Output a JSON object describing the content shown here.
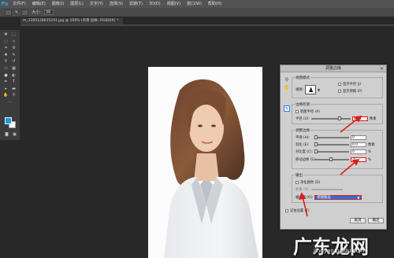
{
  "app": {
    "logo": "Ps"
  },
  "menu": [
    "文件(F)",
    "编辑(E)",
    "图像(I)",
    "图层(L)",
    "文字(Y)",
    "选择(S)",
    "滤镜(T)",
    "3D(D)",
    "视图(V)",
    "窗口(W)",
    "帮助(H)"
  ],
  "options": {
    "size_label": "大小:",
    "size_value": "36"
  },
  "document": {
    "tab_title": "m_1385128635201.jpg @ 100% (背景 副本, RGB/8#) *"
  },
  "dialog": {
    "title": "调整边缘",
    "view_mode": {
      "section": "视图模式",
      "view_label": "视图:",
      "show_radius": "显示半径 (J)",
      "show_original": "显示原稿 (P)"
    },
    "edge_detection": {
      "section": "边缘检测",
      "smart_radius": "智能半径 (A)",
      "radius_label": "半径 (U):",
      "radius_value": "96.5",
      "radius_unit": "像素",
      "radius_fraction": 0.75
    },
    "adjust_edge": {
      "section": "调整边缘",
      "smooth_label": "平滑 (H):",
      "smooth_value": "0",
      "smooth_fraction": 0.0,
      "feather_label": "羽化 (E):",
      "feather_value": "0.0",
      "feather_unit": "像素",
      "feather_fraction": 0.0,
      "contrast_label": "对比度 (C):",
      "contrast_value": "0",
      "contrast_unit": "%",
      "contrast_fraction": 0.0,
      "shift_label": "移动边缘 (S):",
      "shift_value": "-5",
      "shift_unit": "%",
      "shift_fraction": 0.47
    },
    "output": {
      "section": "输出",
      "decontaminate": "净化颜色 (D)",
      "amount_label": "数量 (N):",
      "output_to_label": "输出到 (O):",
      "output_to_value": "新建图层"
    },
    "remember": "记住设置 (T)",
    "cancel": "取消",
    "ok": "确定"
  },
  "watermark": {
    "main": "广东龙网",
    "sub": "jingyan.baidu.com"
  },
  "colors": {
    "accent": "#1d9ce0",
    "annotation": "#e01a1a",
    "select_bg": "#2b6fd6"
  }
}
